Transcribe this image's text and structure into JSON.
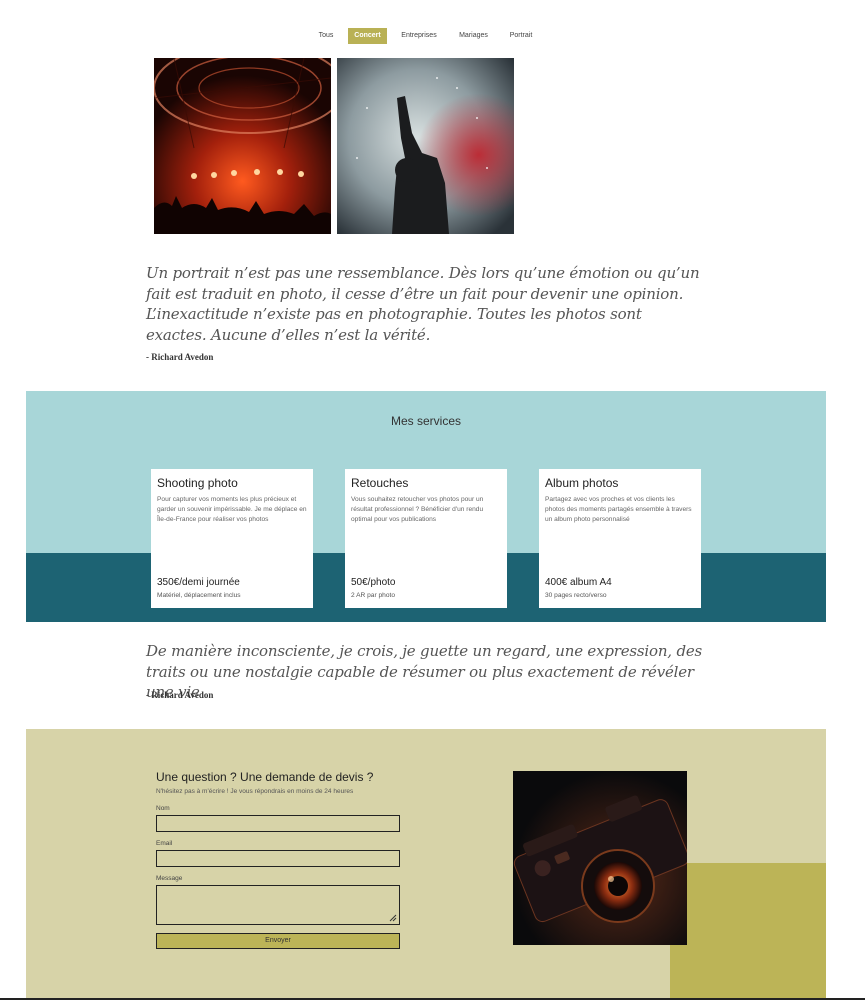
{
  "filters": [
    {
      "label": "Tous",
      "active": false
    },
    {
      "label": "Concert",
      "active": true
    },
    {
      "label": "Entreprises",
      "active": false
    },
    {
      "label": "Mariages",
      "active": false
    },
    {
      "label": "Portrait",
      "active": false
    }
  ],
  "quotes": [
    {
      "text": "Un portrait n’est pas une ressemblance. Dès lors qu’une émotion ou qu’un fait est traduit en photo, il cesse d’être un fait pour devenir une opinion. L’inexactitude n’existe pas en photographie. Toutes les photos sont exactes. Aucune d’elles n’est la vérité.",
      "author": "- Richard Avedon"
    },
    {
      "text": "De manière inconsciente, je crois, je guette un regard, une expression, des traits ou une nostalgie capable de résumer ou plus exactement de révéler une vie",
      "author": "- Richard Avedon"
    }
  ],
  "services": {
    "title": "Mes services",
    "cards": [
      {
        "title": "Shooting photo",
        "description": "Pour capturer vos moments les plus précieux et garder un souvenir impérissable. Je me déplace en Île-de-France pour réaliser vos photos",
        "price": "350€/demi journée",
        "note": "Matériel, déplacement inclus"
      },
      {
        "title": "Retouches",
        "description": "Vous souhaitez retoucher vos photos pour un résultat professionnel ? Bénéficier d'un rendu optimal pour vos publications",
        "price": "50€/photo",
        "note": "2 AR par photo"
      },
      {
        "title": "Album photos",
        "description": "Partagez avec vos proches et vos clients les photos des moments partagés ensemble à travers un album photo personnalisé",
        "price": "400€ album A4",
        "note": "30 pages recto/verso"
      }
    ]
  },
  "contact": {
    "title": "Une question ? Une demande de devis ?",
    "subtitle": "N'hésitez pas à m'écrire ! Je vous répondrais en moins de 24 heures",
    "name_label": "Nom",
    "email_label": "Email",
    "message_label": "Message",
    "submit_label": "Envoyer"
  },
  "colors": {
    "accent": "#b9b155",
    "services_light": "#a8d6d8",
    "services_dark": "#1d6373",
    "contact_bg": "#d7d3a8"
  }
}
